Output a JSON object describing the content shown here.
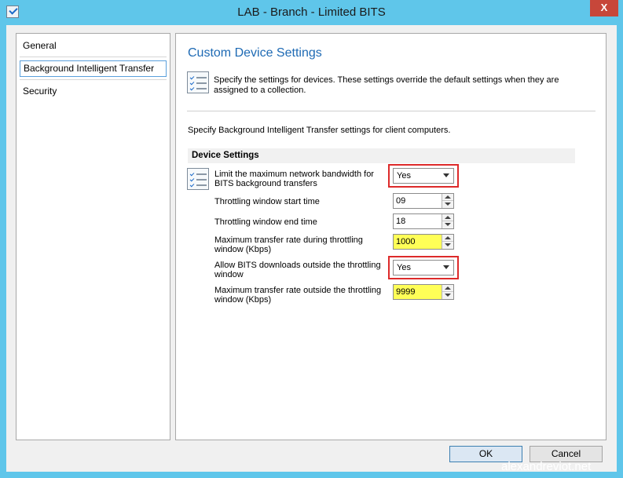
{
  "window": {
    "title": "LAB - Branch - Limited BITS",
    "close_label": "X"
  },
  "nav": {
    "items": [
      {
        "label": "General",
        "selected": false
      },
      {
        "label": "Background Intelligent Transfer",
        "selected": true
      },
      {
        "label": "Security",
        "selected": false
      }
    ]
  },
  "page": {
    "title": "Custom Device Settings",
    "description": "Specify the settings for devices. These settings override the default settings when they are assigned to a collection.",
    "spec_text": "Specify Background Intelligent Transfer settings for client computers.",
    "group_header": "Device Settings"
  },
  "settings": {
    "limit_bandwidth": {
      "label": "Limit the maximum network bandwidth for BITS background transfers",
      "value": "Yes"
    },
    "start_time": {
      "label": "Throttling window start time",
      "value": "09"
    },
    "end_time": {
      "label": "Throttling window end time",
      "value": "18"
    },
    "max_rate_during": {
      "label": "Maximum transfer rate during throttling window (Kbps)",
      "value": "1000"
    },
    "allow_outside": {
      "label": "Allow BITS downloads outside the throttling window",
      "value": "Yes"
    },
    "max_rate_outside": {
      "label": "Maximum transfer rate outside the throttling window (Kbps)",
      "value": "9999"
    }
  },
  "buttons": {
    "ok": "OK",
    "cancel": "Cancel"
  },
  "watermark": "alexandreviot.net",
  "colors": {
    "titlebar": "#5fc6ea",
    "accent_title": "#1e6ab4",
    "highlight_red": "#dd2a2a",
    "highlight_yellow": "#ffff57",
    "close": "#c7473a"
  },
  "icons": [
    "app-icon",
    "settings-list-icon",
    "chevron-down-icon",
    "spin-up-icon",
    "spin-down-icon"
  ]
}
